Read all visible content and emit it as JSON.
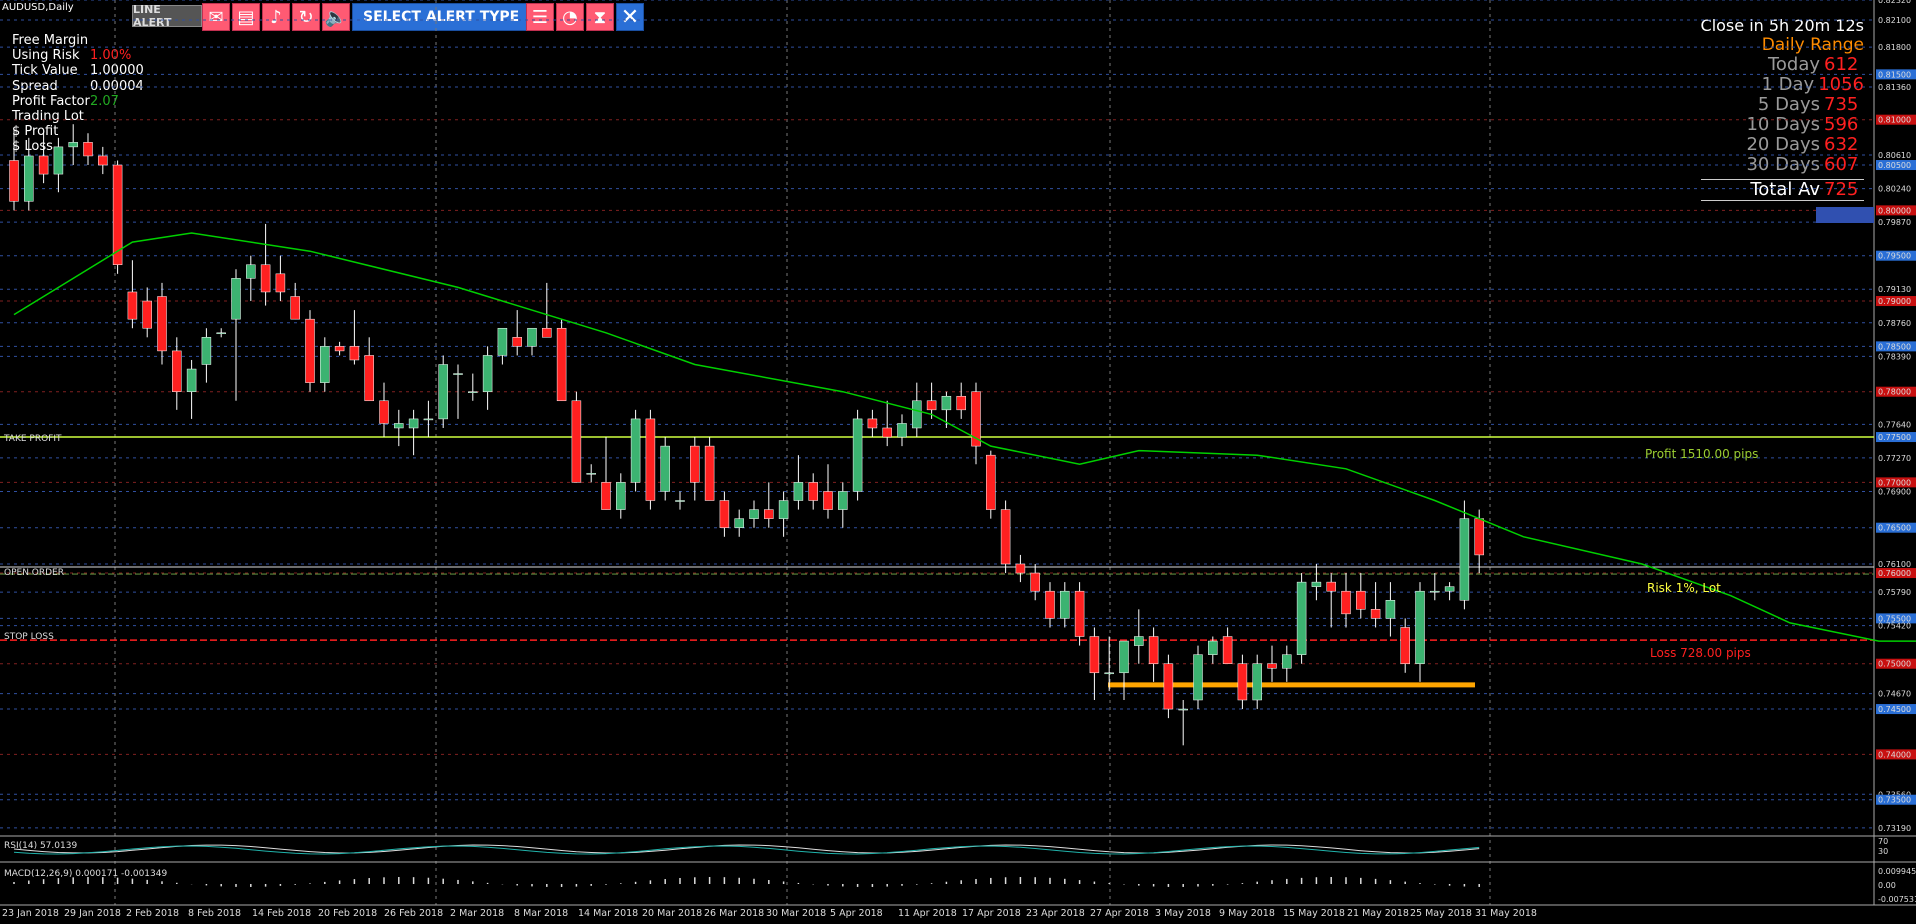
{
  "symbol": "AUDUSD,Daily",
  "toolbar": {
    "line_alert": "LINE ALERT",
    "select_alert": "SELECT ALERT TYPE",
    "icons_left": [
      "envelope-icon",
      "document-icon",
      "music-note-icon",
      "refresh-icon",
      "speaker-icon"
    ],
    "icons_right": [
      "list-icon",
      "timer-icon",
      "hourglass-icon"
    ],
    "close_icon": "close-icon"
  },
  "info_panel": [
    {
      "label": "Free Margin",
      "value": "",
      "color": "#22aa22"
    },
    {
      "label": "Using Risk",
      "value": "1.00%",
      "color": "#ff2020"
    },
    {
      "label": "Tick Value",
      "value": "1.00000",
      "color": "#ffffff"
    },
    {
      "label": "Spread",
      "value": "0.00004",
      "color": "#ffffff"
    },
    {
      "label": "Profit Factor",
      "value": "2.07",
      "color": "#22aa22"
    },
    {
      "label": "Trading Lot",
      "value": "",
      "color": "#22aa22"
    },
    {
      "label": "$ Profit",
      "value": "",
      "color": "#22aa22"
    },
    {
      "label": "$ Loss",
      "value": "",
      "color": "#ff2020"
    }
  ],
  "daily_range": {
    "countdown": "Close in 5h 20m 12s",
    "title": "Daily Range",
    "rows": [
      {
        "label": "Today",
        "value": "612"
      },
      {
        "label": "1 Day",
        "value": "1056"
      },
      {
        "label": "5 Days",
        "value": "735"
      },
      {
        "label": "10 Days",
        "value": "596"
      },
      {
        "label": "20 Days",
        "value": "632"
      },
      {
        "label": "30 Days",
        "value": "607"
      }
    ],
    "total_label": "Total Av",
    "total_value": "725"
  },
  "trade_labels": {
    "take_profit": "TAKE PROFIT",
    "open_order": "OPEN ORDER",
    "stop_loss": "STOP LOSS",
    "profit_text": "Profit 1510.00 pips",
    "risk_text": "Risk 1%, Lot",
    "loss_text": "Loss 728.00 pips"
  },
  "indicators": {
    "rsi_label": "RSI(14) 57.0139",
    "macd_label": "MACD(12,26,9) 0.000171 -0.001349",
    "rsi_levels": [
      "70",
      "30"
    ],
    "macd_axis": [
      "0.009945",
      "0.00",
      "-0.007531"
    ]
  },
  "colors": {
    "bull": "#3cb371",
    "bear": "#ff2020",
    "ma": "#00d000",
    "take_profit": "#d0ff40",
    "stop_loss": "#ff2020",
    "support": "#ffa500",
    "grid": "#2a2a2a"
  },
  "chart_data": {
    "type": "candlestick",
    "title": "AUDUSD,Daily",
    "ylim": [
      0.731,
      0.8232
    ],
    "price_ticks": [
      "0.82320",
      "0.82100",
      "0.81800",
      "0.81500",
      "0.81360",
      "0.81000",
      "0.80610",
      "0.80500",
      "0.80240",
      "0.80000",
      "0.79870",
      "0.79500",
      "0.79130",
      "0.79000",
      "0.78760",
      "0.78500",
      "0.78390",
      "0.78000",
      "0.77640",
      "0.77500",
      "0.77270",
      "0.77000",
      "0.76900",
      "0.76500",
      "0.76100",
      "0.76000",
      "0.75790",
      "0.75500",
      "0.75420",
      "0.75000",
      "0.74670",
      "0.74500",
      "0.74000",
      "0.73560",
      "0.73500",
      "0.73190"
    ],
    "date_labels": [
      "23 Jan 2018",
      "29 Jan 2018",
      "2 Feb 2018",
      "8 Feb 2018",
      "14 Feb 2018",
      "20 Feb 2018",
      "26 Feb 2018",
      "2 Mar 2018",
      "8 Mar 2018",
      "14 Mar 2018",
      "20 Mar 2018",
      "26 Mar 2018",
      "30 Mar 2018",
      "5 Apr 2018",
      "11 Apr 2018",
      "17 Apr 2018",
      "23 Apr 2018",
      "27 Apr 2018",
      "3 May 2018",
      "9 May 2018",
      "15 May 2018",
      "21 May 2018",
      "25 May 2018",
      "31 May 2018"
    ],
    "candles": [
      [
        0.8055,
        0.809,
        0.8,
        0.801
      ],
      [
        0.801,
        0.808,
        0.8,
        0.806
      ],
      [
        0.806,
        0.8085,
        0.803,
        0.804
      ],
      [
        0.804,
        0.808,
        0.802,
        0.807
      ],
      [
        0.807,
        0.8095,
        0.805,
        0.8075
      ],
      [
        0.8075,
        0.8085,
        0.805,
        0.806
      ],
      [
        0.806,
        0.807,
        0.804,
        0.805
      ],
      [
        0.805,
        0.8055,
        0.793,
        0.794
      ],
      [
        0.791,
        0.7945,
        0.787,
        0.788
      ],
      [
        0.79,
        0.7915,
        0.786,
        0.787
      ],
      [
        0.7905,
        0.792,
        0.783,
        0.7845
      ],
      [
        0.7845,
        0.786,
        0.778,
        0.78
      ],
      [
        0.78,
        0.7835,
        0.777,
        0.7825
      ],
      [
        0.783,
        0.787,
        0.781,
        0.786
      ],
      [
        0.7865,
        0.787,
        0.786,
        0.7865
      ],
      [
        0.788,
        0.7935,
        0.779,
        0.7925
      ],
      [
        0.7925,
        0.795,
        0.79,
        0.794
      ],
      [
        0.794,
        0.7985,
        0.7895,
        0.791
      ],
      [
        0.793,
        0.795,
        0.79,
        0.791
      ],
      [
        0.7905,
        0.792,
        0.788,
        0.788
      ],
      [
        0.788,
        0.789,
        0.78,
        0.781
      ],
      [
        0.781,
        0.786,
        0.78,
        0.785
      ],
      [
        0.785,
        0.7855,
        0.784,
        0.7845
      ],
      [
        0.785,
        0.789,
        0.783,
        0.7835
      ],
      [
        0.784,
        0.786,
        0.779,
        0.779
      ],
      [
        0.779,
        0.781,
        0.775,
        0.7765
      ],
      [
        0.776,
        0.778,
        0.774,
        0.7765
      ],
      [
        0.776,
        0.778,
        0.773,
        0.777
      ],
      [
        0.777,
        0.779,
        0.775,
        0.777
      ],
      [
        0.777,
        0.784,
        0.776,
        0.783
      ],
      [
        0.782,
        0.783,
        0.777,
        0.782
      ],
      [
        0.78,
        0.782,
        0.779,
        0.78
      ],
      [
        0.78,
        0.785,
        0.778,
        0.784
      ],
      [
        0.784,
        0.787,
        0.783,
        0.787
      ],
      [
        0.786,
        0.789,
        0.784,
        0.785
      ],
      [
        0.785,
        0.787,
        0.784,
        0.787
      ],
      [
        0.787,
        0.792,
        0.786,
        0.786
      ],
      [
        0.787,
        0.788,
        0.779,
        0.779
      ],
      [
        0.779,
        0.78,
        0.77,
        0.77
      ],
      [
        0.771,
        0.772,
        0.77,
        0.771
      ],
      [
        0.77,
        0.775,
        0.767,
        0.767
      ],
      [
        0.767,
        0.771,
        0.766,
        0.77
      ],
      [
        0.77,
        0.778,
        0.769,
        0.777
      ],
      [
        0.777,
        0.778,
        0.767,
        0.768
      ],
      [
        0.769,
        0.775,
        0.768,
        0.774
      ],
      [
        0.768,
        0.769,
        0.767,
        0.768
      ],
      [
        0.774,
        0.775,
        0.768,
        0.77
      ],
      [
        0.774,
        0.775,
        0.768,
        0.768
      ],
      [
        0.768,
        0.769,
        0.764,
        0.765
      ],
      [
        0.765,
        0.767,
        0.764,
        0.766
      ],
      [
        0.766,
        0.768,
        0.765,
        0.767
      ],
      [
        0.767,
        0.77,
        0.765,
        0.766
      ],
      [
        0.766,
        0.769,
        0.764,
        0.768
      ],
      [
        0.768,
        0.773,
        0.767,
        0.77
      ],
      [
        0.77,
        0.771,
        0.767,
        0.768
      ],
      [
        0.769,
        0.772,
        0.766,
        0.767
      ],
      [
        0.767,
        0.77,
        0.765,
        0.769
      ],
      [
        0.769,
        0.778,
        0.768,
        0.777
      ],
      [
        0.777,
        0.778,
        0.775,
        0.776
      ],
      [
        0.776,
        0.779,
        0.774,
        0.775
      ],
      [
        0.775,
        0.7775,
        0.774,
        0.7765
      ],
      [
        0.776,
        0.781,
        0.775,
        0.779
      ],
      [
        0.779,
        0.781,
        0.777,
        0.778
      ],
      [
        0.778,
        0.78,
        0.776,
        0.7795
      ],
      [
        0.7795,
        0.781,
        0.777,
        0.778
      ],
      [
        0.78,
        0.781,
        0.772,
        0.774
      ],
      [
        0.773,
        0.7735,
        0.766,
        0.767
      ],
      [
        0.767,
        0.768,
        0.76,
        0.761
      ],
      [
        0.761,
        0.762,
        0.759,
        0.76
      ],
      [
        0.76,
        0.761,
        0.757,
        0.758
      ],
      [
        0.758,
        0.759,
        0.754,
        0.755
      ],
      [
        0.755,
        0.759,
        0.754,
        0.758
      ],
      [
        0.758,
        0.759,
        0.752,
        0.753
      ],
      [
        0.753,
        0.754,
        0.746,
        0.749
      ],
      [
        0.749,
        0.753,
        0.747,
        0.749
      ],
      [
        0.749,
        0.751,
        0.746,
        0.7525
      ],
      [
        0.752,
        0.756,
        0.75,
        0.753
      ],
      [
        0.753,
        0.754,
        0.748,
        0.75
      ],
      [
        0.75,
        0.751,
        0.744,
        0.745
      ],
      [
        0.745,
        0.746,
        0.741,
        0.745
      ],
      [
        0.746,
        0.752,
        0.745,
        0.751
      ],
      [
        0.751,
        0.753,
        0.75,
        0.7525
      ],
      [
        0.753,
        0.754,
        0.75,
        0.75
      ],
      [
        0.75,
        0.751,
        0.745,
        0.746
      ],
      [
        0.746,
        0.751,
        0.745,
        0.75
      ],
      [
        0.75,
        0.752,
        0.748,
        0.7495
      ],
      [
        0.7495,
        0.752,
        0.748,
        0.751
      ],
      [
        0.751,
        0.76,
        0.75,
        0.759
      ],
      [
        0.7585,
        0.761,
        0.757,
        0.759
      ],
      [
        0.759,
        0.76,
        0.754,
        0.758
      ],
      [
        0.758,
        0.76,
        0.754,
        0.7555
      ],
      [
        0.758,
        0.76,
        0.755,
        0.756
      ],
      [
        0.756,
        0.759,
        0.754,
        0.755
      ],
      [
        0.755,
        0.759,
        0.753,
        0.757
      ],
      [
        0.754,
        0.755,
        0.749,
        0.75
      ],
      [
        0.75,
        0.759,
        0.748,
        0.758
      ],
      [
        0.758,
        0.76,
        0.757,
        0.758
      ],
      [
        0.758,
        0.759,
        0.757,
        0.7585
      ],
      [
        0.757,
        0.768,
        0.756,
        0.766
      ],
      [
        0.766,
        0.767,
        0.76,
        0.762
      ]
    ],
    "moving_average": [
      [
        0,
        0.7885
      ],
      [
        8,
        0.7965
      ],
      [
        12,
        0.7975
      ],
      [
        20,
        0.7955
      ],
      [
        30,
        0.7915
      ],
      [
        40,
        0.7865
      ],
      [
        46,
        0.783
      ],
      [
        56,
        0.78
      ],
      [
        62,
        0.7775
      ],
      [
        66,
        0.774
      ],
      [
        72,
        0.772
      ],
      [
        76,
        0.7735
      ],
      [
        84,
        0.773
      ],
      [
        90,
        0.7715
      ],
      [
        96,
        0.768
      ],
      [
        102,
        0.764
      ],
      [
        110,
        0.761
      ],
      [
        116,
        0.7575
      ],
      [
        120,
        0.7545
      ],
      [
        126,
        0.7525
      ],
      [
        134,
        0.7525
      ],
      [
        142,
        0.7522
      ],
      [
        150,
        0.7525
      ],
      [
        155,
        0.7543
      ]
    ],
    "take_profit": 0.775,
    "open_order": 0.76,
    "stop_loss": 0.7526,
    "support_line": [
      0.748
    ]
  }
}
